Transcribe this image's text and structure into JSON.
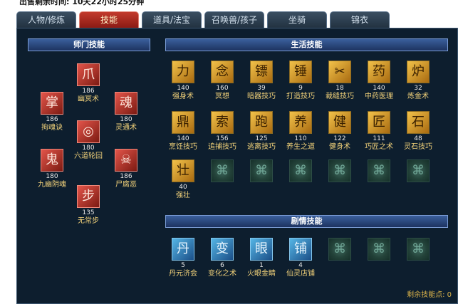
{
  "top_text": "出售剩余时间: 10天22小时25分钟",
  "tabs": [
    {
      "label": "人物/修炼",
      "active": false
    },
    {
      "label": "技能",
      "active": true
    },
    {
      "label": "道具/法宝",
      "active": false
    },
    {
      "label": "召唤兽/孩子",
      "active": false
    },
    {
      "label": "坐骑",
      "active": false
    },
    {
      "label": "锦衣",
      "active": false
    }
  ],
  "sections": {
    "sect_title": "师门技能",
    "life_title": "生活技能",
    "plot_title": "剧情技能"
  },
  "sect_skills": [
    {
      "level": "186",
      "name": "幽冥术",
      "icon": "ghost-claw-icon",
      "glyph": "爪"
    },
    {
      "level": "186",
      "name": "拘魂诀",
      "icon": "soul-hand-icon",
      "glyph": "掌"
    },
    {
      "level": "180",
      "name": "灵通术",
      "icon": "hooded-spirit-icon",
      "glyph": "魂"
    },
    {
      "level": "180",
      "name": "六道轮回",
      "icon": "wheel-icon",
      "glyph": "◎"
    },
    {
      "level": "180",
      "name": "九幽阴魂",
      "icon": "spirits-icon",
      "glyph": "鬼"
    },
    {
      "level": "186",
      "name": "尸腐恶",
      "icon": "skull-icon",
      "glyph": "☠"
    },
    {
      "level": "135",
      "name": "无常步",
      "icon": "step-icon",
      "glyph": "步"
    }
  ],
  "life_skills": [
    {
      "level": "140",
      "name": "强身术",
      "glyph": "力"
    },
    {
      "level": "160",
      "name": "冥想",
      "glyph": "念"
    },
    {
      "level": "39",
      "name": "暗器技巧",
      "glyph": "镖"
    },
    {
      "level": "9",
      "name": "打造技巧",
      "glyph": "锤"
    },
    {
      "level": "18",
      "name": "裁缝技巧",
      "glyph": "✂"
    },
    {
      "level": "140",
      "name": "中药医理",
      "glyph": "药"
    },
    {
      "level": "32",
      "name": "炼金术",
      "glyph": "炉"
    },
    {
      "level": "140",
      "name": "烹饪技巧",
      "glyph": "鼎"
    },
    {
      "level": "156",
      "name": "追捕技巧",
      "glyph": "索"
    },
    {
      "level": "125",
      "name": "逃离技巧",
      "glyph": "跑"
    },
    {
      "level": "110",
      "name": "养生之道",
      "glyph": "养"
    },
    {
      "level": "122",
      "name": "健身术",
      "glyph": "健"
    },
    {
      "level": "111",
      "name": "巧匠之术",
      "glyph": "匠"
    },
    {
      "level": "48",
      "name": "灵石技巧",
      "glyph": "石"
    },
    {
      "level": "40",
      "name": "强壮",
      "glyph": "壮"
    }
  ],
  "plot_skills": [
    {
      "level": "5",
      "name": "丹元济会",
      "glyph": "丹"
    },
    {
      "level": "6",
      "name": "变化之术",
      "glyph": "变"
    },
    {
      "level": "1",
      "name": "火眼金睛",
      "glyph": "眼"
    },
    {
      "level": "4",
      "name": "仙灵店铺",
      "glyph": "铺"
    }
  ],
  "empty_glyph": "⌘",
  "remaining_label": "剩余技能点: 0"
}
